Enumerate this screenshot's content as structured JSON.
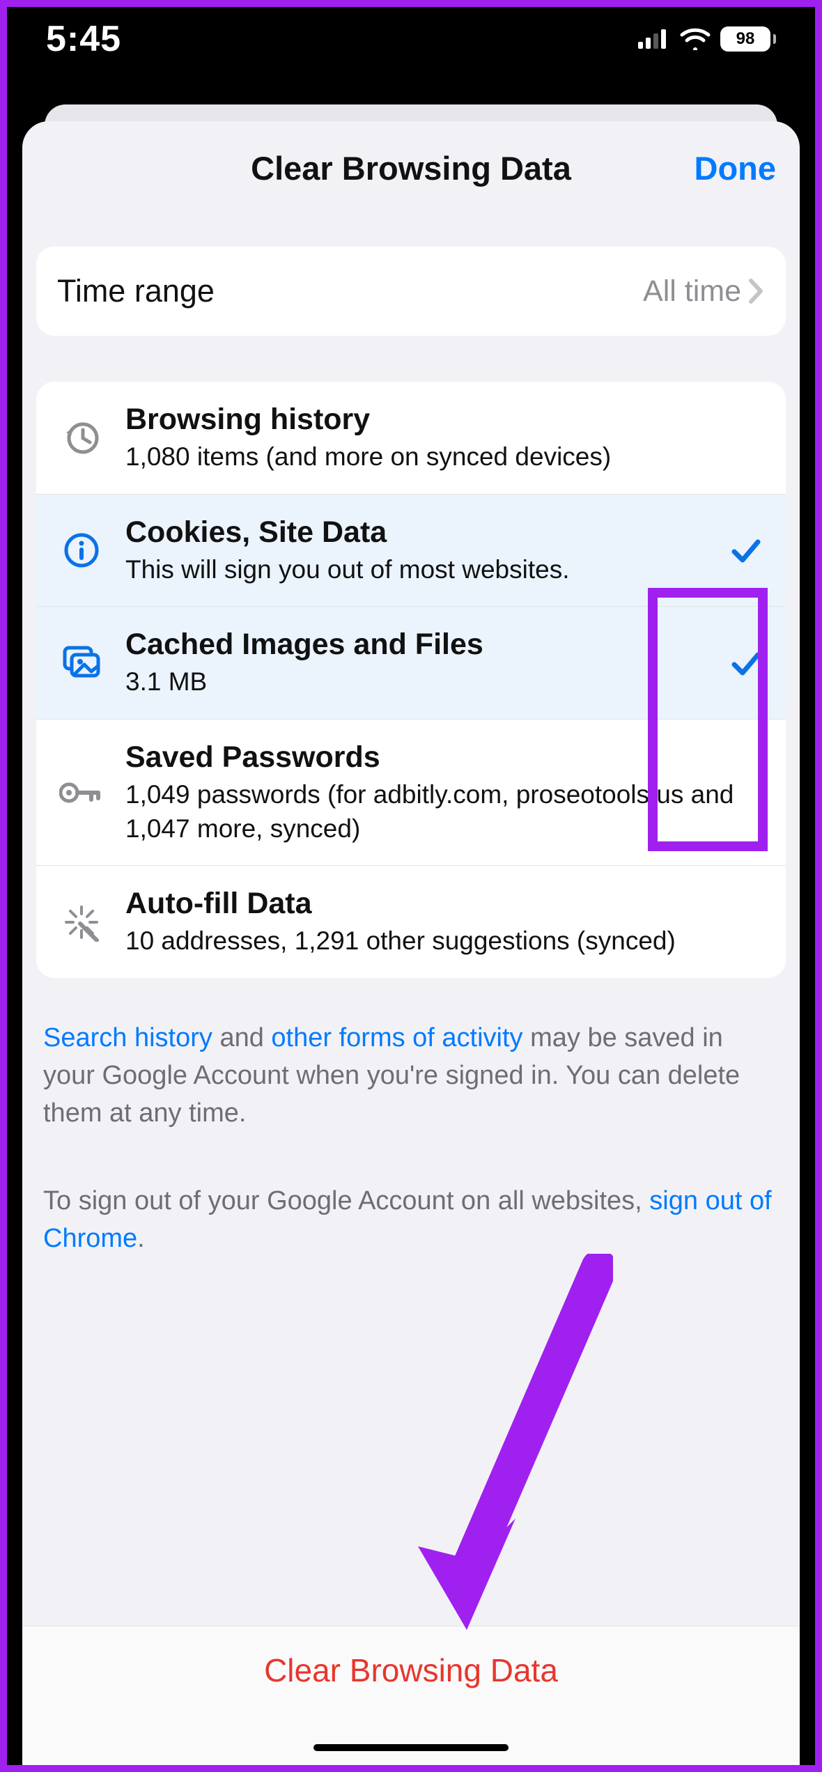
{
  "statusbar": {
    "time": "5:45",
    "battery": "98"
  },
  "sheet": {
    "title": "Clear Browsing Data",
    "done": "Done"
  },
  "time_range": {
    "label": "Time range",
    "value": "All time"
  },
  "items": [
    {
      "icon": "history",
      "title": "Browsing history",
      "sub": "1,080 items (and more on synced devices)",
      "selected": false
    },
    {
      "icon": "info",
      "title": "Cookies, Site Data",
      "sub": "This will sign you out of most websites.",
      "selected": true
    },
    {
      "icon": "images",
      "title": "Cached Images and Files",
      "sub": "3.1 MB",
      "selected": true
    },
    {
      "icon": "key",
      "title": "Saved Passwords",
      "sub": "1,049 passwords (for adbitly.com, proseotools.us and 1,047 more, synced)",
      "selected": false
    },
    {
      "icon": "wand",
      "title": "Auto-fill Data",
      "sub": "10 addresses, 1,291 other suggestions (synced)",
      "selected": false
    }
  ],
  "footer": {
    "p1_link1": "Search history",
    "p1_mid": " and ",
    "p1_link2": "other forms of activity",
    "p1_tail": " may be saved in your Google Account when you're signed in. You can delete them at any time.",
    "p2_lead": "To sign out of your Google Account on all websites, ",
    "p2_link": "sign out of Chrome",
    "p2_tail": "."
  },
  "action": {
    "clear": "Clear Browsing Data"
  }
}
